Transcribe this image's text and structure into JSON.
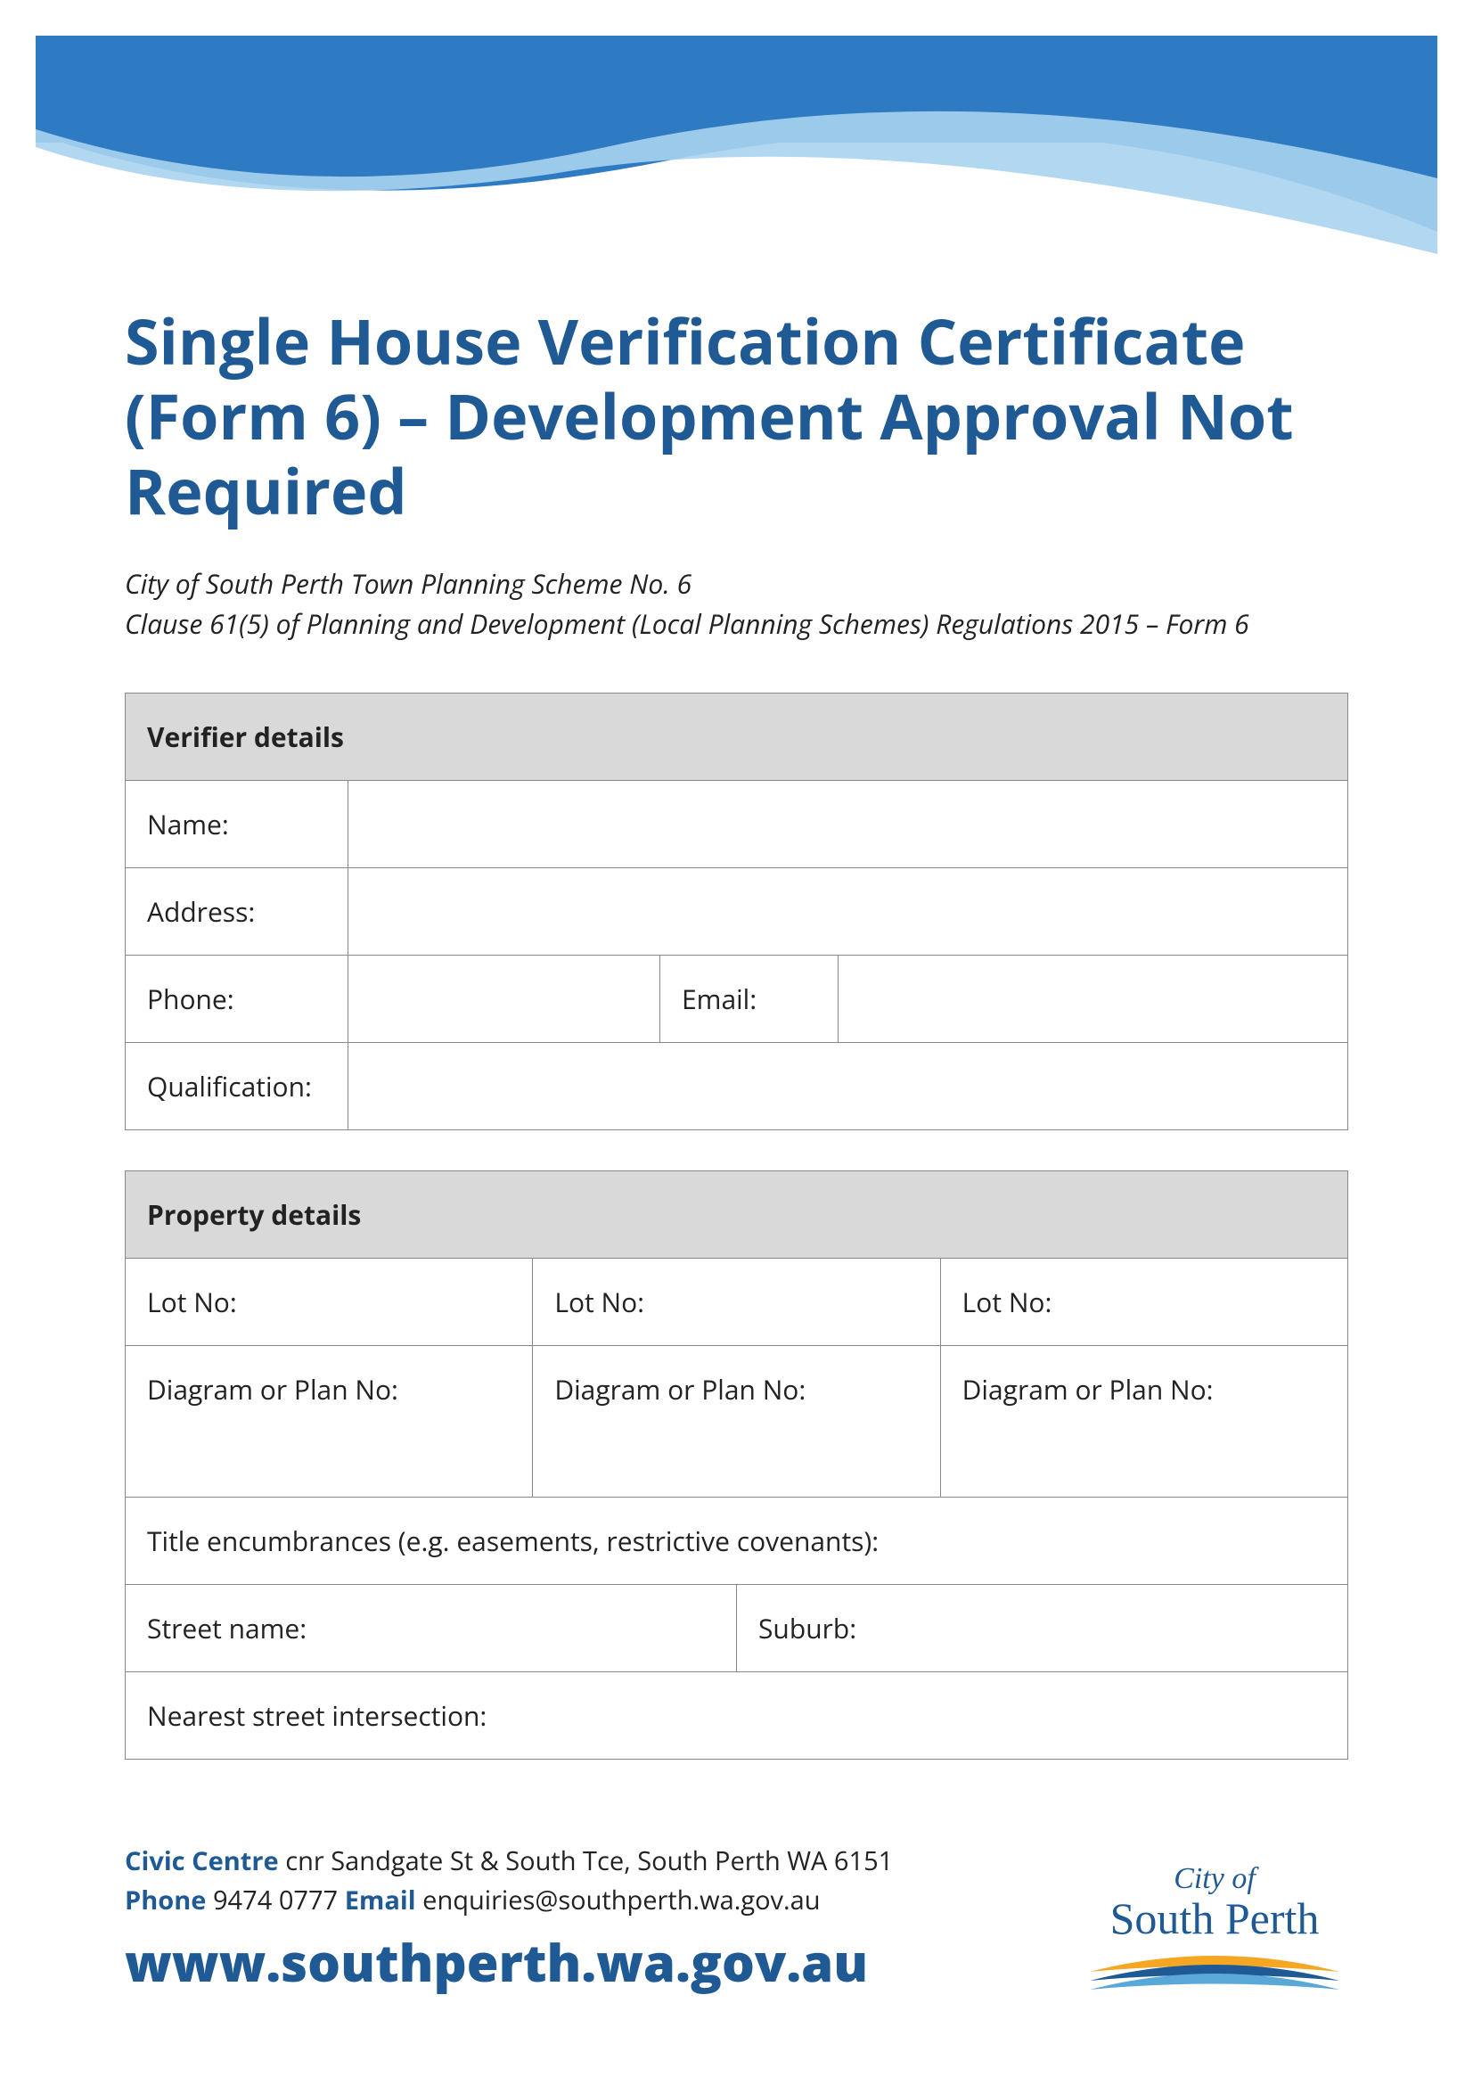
{
  "title": "Single House Verification Certificate (Form 6) – Development Approval Not Required",
  "subtitle_line1": "City of South Perth Town Planning Scheme No. 6",
  "subtitle_line2": "Clause 61(5) of Planning and Development (Local Planning Schemes) Regulations 2015 – Form 6",
  "verifier": {
    "header": "Verifier details",
    "name_label": "Name:",
    "address_label": "Address:",
    "phone_label": "Phone:",
    "email_label": "Email:",
    "qualification_label": "Qualification:"
  },
  "property": {
    "header": "Property details",
    "lot_no_label": "Lot No:",
    "diagram_label": "Diagram or Plan No:",
    "title_encumbrances_label": "Title encumbrances (e.g. easements, restrictive covenants):",
    "street_name_label": "Street name:",
    "suburb_label": "Suburb:",
    "nearest_intersection_label": "Nearest street intersection:"
  },
  "footer": {
    "civic_label": "Civic Centre",
    "civic_value": " cnr Sandgate St & South Tce, South Perth WA 6151",
    "phone_label": "Phone",
    "phone_value": " 9474 0777  ",
    "email_label": "Email",
    "email_value": " enquiries@southperth.wa.gov.au",
    "website": "www.southperth.wa.gov.au",
    "logo_city": "City of",
    "logo_name": "South Perth"
  }
}
